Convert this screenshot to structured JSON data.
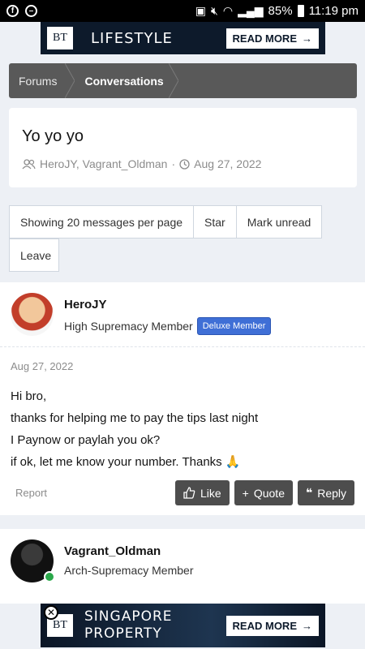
{
  "status_bar": {
    "battery": "85%",
    "time": "11:19 pm"
  },
  "ads": {
    "top": {
      "logo": "BT",
      "title": "LIFESTYLE",
      "button": "READ MORE"
    },
    "bottom": {
      "logo": "BT",
      "title": "SINGAPORE PROPERTY",
      "button": "READ MORE"
    }
  },
  "breadcrumb": {
    "items": [
      "Forums",
      "Conversations"
    ]
  },
  "thread": {
    "title": "Yo yo yo",
    "participants": "HeroJY, Vagrant_Oldman",
    "date": "Aug 27, 2022",
    "separator": "·"
  },
  "toolbar": {
    "per_page": "Showing 20 messages per page",
    "star": "Star",
    "mark_unread": "Mark unread",
    "leave": "Leave"
  },
  "messages": [
    {
      "username": "HeroJY",
      "user_title": "High Supremacy Member",
      "badge": "Deluxe Member",
      "date": "Aug 27, 2022",
      "lines": [
        "Hi bro,",
        "thanks for helping me to pay the tips last night",
        "I Paynow or paylah you ok?",
        "if ok, let me know your number. Thanks"
      ],
      "report": "Report",
      "like": "Like",
      "quote": "Quote",
      "reply": "Reply"
    },
    {
      "username": "Vagrant_Oldman",
      "user_title": "Arch-Supremacy Member"
    }
  ]
}
